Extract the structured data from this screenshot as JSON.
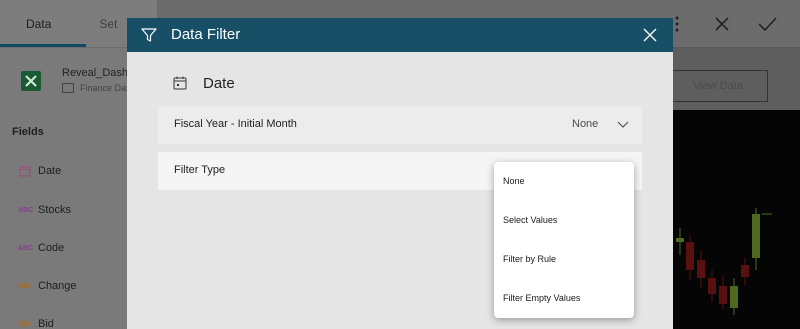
{
  "app": {
    "tabs": [
      {
        "label": "Data"
      },
      {
        "label": "Set"
      }
    ],
    "datasource": {
      "name": "Reveal_Dashb",
      "subtitle": "Finance Das"
    },
    "fields_heading": "Fields",
    "fields": [
      {
        "type_badge": "date-icon",
        "label": "Date"
      },
      {
        "type_badge": "ABC",
        "label": "Stocks"
      },
      {
        "type_badge": "ABC",
        "label": "Code"
      },
      {
        "type_badge": "123",
        "label": "Change"
      },
      {
        "type_badge": "123",
        "label": "Bid"
      }
    ],
    "view_data_label": "View Data"
  },
  "modal": {
    "title": "Data Filter",
    "field_name": "Date",
    "fiscal_row": {
      "label": "Fiscal Year - Initial Month",
      "value": "None"
    },
    "filter_type_row": {
      "label": "Filter Type"
    },
    "menu": {
      "options": [
        "None",
        "Select Values",
        "Filter by Rule",
        "Filter Empty Values"
      ]
    }
  },
  "colors": {
    "header": "#174f67",
    "tab_underline": "#134a5f",
    "abc_badge": "#8a3b8f",
    "num_badge": "#a86a1e"
  }
}
